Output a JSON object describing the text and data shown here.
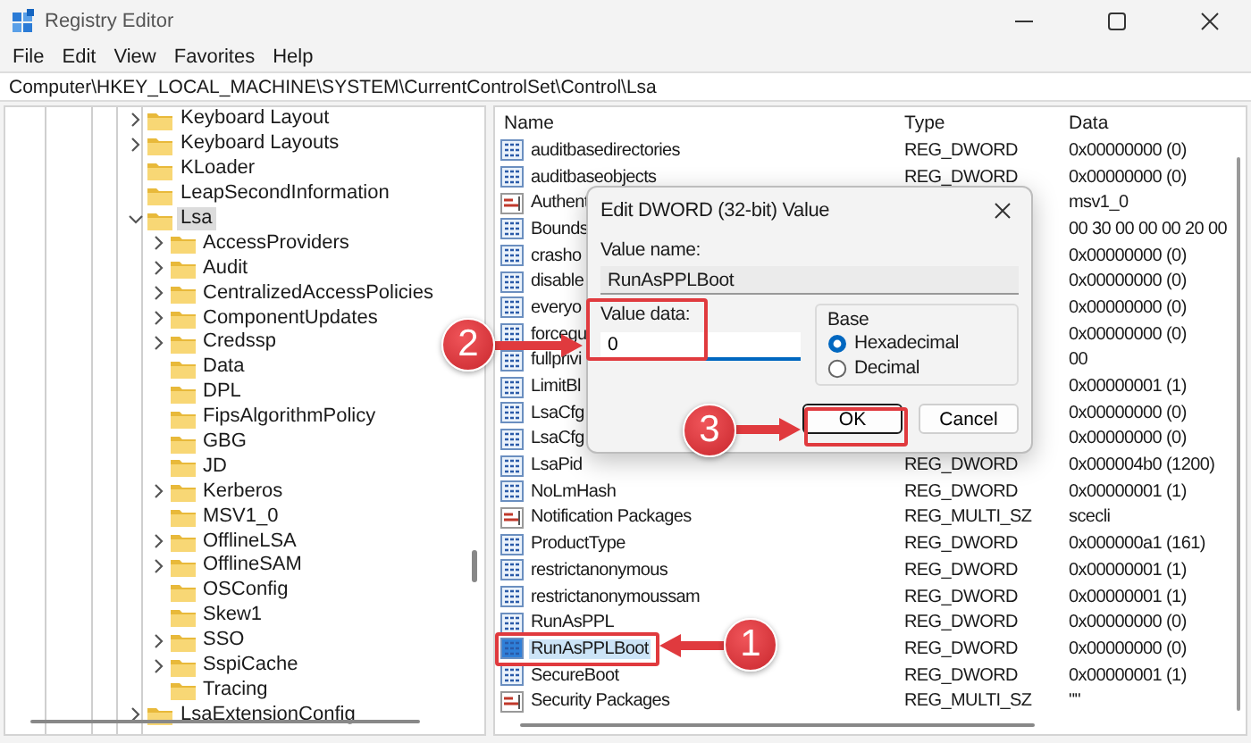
{
  "window": {
    "title": "Registry Editor"
  },
  "menu": [
    "File",
    "Edit",
    "View",
    "Favorites",
    "Help"
  ],
  "address": "Computer\\HKEY_LOCAL_MACHINE\\SYSTEM\\CurrentControlSet\\Control\\Lsa",
  "tree": {
    "items": [
      {
        "label": "Keyboard Layout",
        "expandable": true,
        "expanded": false,
        "selected": false
      },
      {
        "label": "Keyboard Layouts",
        "expandable": true,
        "expanded": false,
        "selected": false
      },
      {
        "label": "KLoader",
        "expandable": false,
        "selected": false
      },
      {
        "label": "LeapSecondInformation",
        "expandable": false,
        "selected": false
      },
      {
        "label": "Lsa",
        "expandable": true,
        "expanded": true,
        "selected": true,
        "children": [
          {
            "label": "AccessProviders",
            "expandable": true,
            "expanded": false,
            "selected": false
          },
          {
            "label": "Audit",
            "expandable": true,
            "expanded": false,
            "selected": false
          },
          {
            "label": "CentralizedAccessPolicies",
            "expandable": true,
            "expanded": false,
            "selected": false
          },
          {
            "label": "ComponentUpdates",
            "expandable": true,
            "expanded": false,
            "selected": false
          },
          {
            "label": "Credssp",
            "expandable": true,
            "expanded": false,
            "selected": false
          },
          {
            "label": "Data",
            "expandable": false,
            "selected": false
          },
          {
            "label": "DPL",
            "expandable": false,
            "selected": false
          },
          {
            "label": "FipsAlgorithmPolicy",
            "expandable": false,
            "selected": false
          },
          {
            "label": "GBG",
            "expandable": false,
            "selected": false
          },
          {
            "label": "JD",
            "expandable": false,
            "selected": false
          },
          {
            "label": "Kerberos",
            "expandable": true,
            "expanded": false,
            "selected": false
          },
          {
            "label": "MSV1_0",
            "expandable": false,
            "selected": false
          },
          {
            "label": "OfflineLSA",
            "expandable": true,
            "expanded": false,
            "selected": false
          },
          {
            "label": "OfflineSAM",
            "expandable": true,
            "expanded": false,
            "selected": false
          },
          {
            "label": "OSConfig",
            "expandable": false,
            "selected": false
          },
          {
            "label": "Skew1",
            "expandable": false,
            "selected": false
          },
          {
            "label": "SSO",
            "expandable": true,
            "expanded": false,
            "selected": false
          },
          {
            "label": "SspiCache",
            "expandable": true,
            "expanded": false,
            "selected": false
          },
          {
            "label": "Tracing",
            "expandable": false,
            "selected": false
          }
        ]
      },
      {
        "label": "LsaExtensionConfig",
        "expandable": true,
        "expanded": false,
        "selected": false
      }
    ]
  },
  "list": {
    "columns": [
      "Name",
      "Type",
      "Data"
    ],
    "rows": [
      {
        "kind": "binary",
        "name": "auditbasedirectories",
        "type": "REG_DWORD",
        "data": "0x00000000 (0)",
        "selected": false
      },
      {
        "kind": "binary",
        "name": "auditbaseobjects",
        "type": "REG_DWORD",
        "data": "0x00000000 (0)",
        "selected": false
      },
      {
        "kind": "string",
        "name": "Authent",
        "data": "msv1_0",
        "selected": false
      },
      {
        "kind": "binary",
        "name": "Bounds",
        "data": "00 30 00 00 00 20 00",
        "selected": false
      },
      {
        "kind": "binary",
        "name": "crasho",
        "data": "0x00000000 (0)",
        "selected": false
      },
      {
        "kind": "binary",
        "name": "disable",
        "data": "0x00000000 (0)",
        "selected": false
      },
      {
        "kind": "binary",
        "name": "everyo",
        "data": "0x00000000 (0)",
        "selected": false
      },
      {
        "kind": "binary",
        "name": "forcegu",
        "data": "0x00000000 (0)",
        "selected": false
      },
      {
        "kind": "binary",
        "name": "fullprivi",
        "data": "00",
        "selected": false
      },
      {
        "kind": "binary",
        "name": "LimitBl",
        "data": "0x00000001 (1)",
        "selected": false
      },
      {
        "kind": "binary",
        "name": "LsaCfg",
        "data": "0x00000000 (0)",
        "selected": false
      },
      {
        "kind": "binary",
        "name": "LsaCfg",
        "data": "0x00000000 (0)",
        "selected": false
      },
      {
        "kind": "binary",
        "name": "LsaPid",
        "type": "REG_DWORD",
        "data": "0x000004b0 (1200)",
        "selected": false
      },
      {
        "kind": "binary",
        "name": "NoLmHash",
        "type": "REG_DWORD",
        "data": "0x00000001 (1)",
        "selected": false
      },
      {
        "kind": "string",
        "name": "Notification Packages",
        "type": "REG_MULTI_SZ",
        "data": "scecli",
        "selected": false
      },
      {
        "kind": "binary",
        "name": "ProductType",
        "type": "REG_DWORD",
        "data": "0x000000a1 (161)",
        "selected": false
      },
      {
        "kind": "binary",
        "name": "restrictanonymous",
        "type": "REG_DWORD",
        "data": "0x00000001 (1)",
        "selected": false
      },
      {
        "kind": "binary",
        "name": "restrictanonymoussam",
        "type": "REG_DWORD",
        "data": "0x00000001 (1)",
        "selected": false
      },
      {
        "kind": "binary",
        "name": "RunAsPPL",
        "type": "REG_DWORD",
        "data": "0x00000000 (0)",
        "selected": false
      },
      {
        "kind": "binary",
        "name": "RunAsPPLBoot",
        "type": "REG_DWORD",
        "data": "0x00000000 (0)",
        "selected": true
      },
      {
        "kind": "binary",
        "name": "SecureBoot",
        "type": "REG_DWORD",
        "data": "0x00000001 (1)",
        "selected": false
      },
      {
        "kind": "string",
        "name": "Security Packages",
        "type": "REG_MULTI_SZ",
        "data": "\"\"",
        "selected": false
      }
    ]
  },
  "dialog": {
    "title": "Edit DWORD (32-bit) Value",
    "value_name_label": "Value name:",
    "value_name": "RunAsPPLBoot",
    "value_data_label": "Value data:",
    "value_data": "0",
    "base_label": "Base",
    "bases": [
      {
        "label": "Hexadecimal",
        "selected": true
      },
      {
        "label": "Decimal",
        "selected": false
      }
    ],
    "buttons": [
      "OK",
      "Cancel"
    ]
  },
  "callouts": [
    {
      "number": "2"
    },
    {
      "number": "3"
    },
    {
      "number": "1"
    }
  ]
}
